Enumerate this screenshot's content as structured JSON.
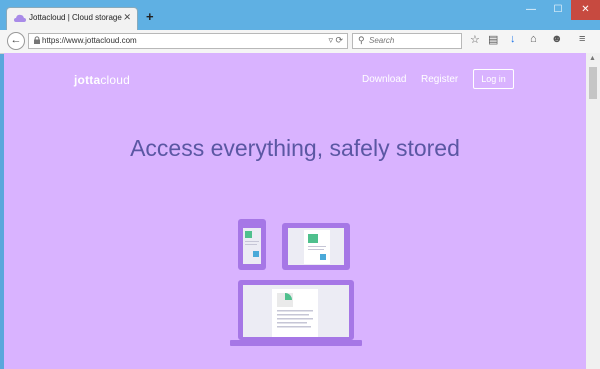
{
  "browser": {
    "tab_title": "Jottacloud | Cloud storage ...",
    "tab_close": "✕",
    "new_tab": "+",
    "url": "https://www.jottacloud.com",
    "search_placeholder": "Search",
    "window_min": "—",
    "window_max": "☐",
    "window_close": "✕"
  },
  "site": {
    "logo_part1": "jotta",
    "logo_part2": "cloud",
    "nav": [
      "Download",
      "Register"
    ],
    "login": "Log in",
    "headline": "Access everything, safely stored"
  },
  "colors": {
    "page_bg": "#d9b3ff",
    "headline": "#5b57a3",
    "device_frame": "#a677e6",
    "screen": "#ececf4",
    "accent_green": "#4fc08d"
  }
}
